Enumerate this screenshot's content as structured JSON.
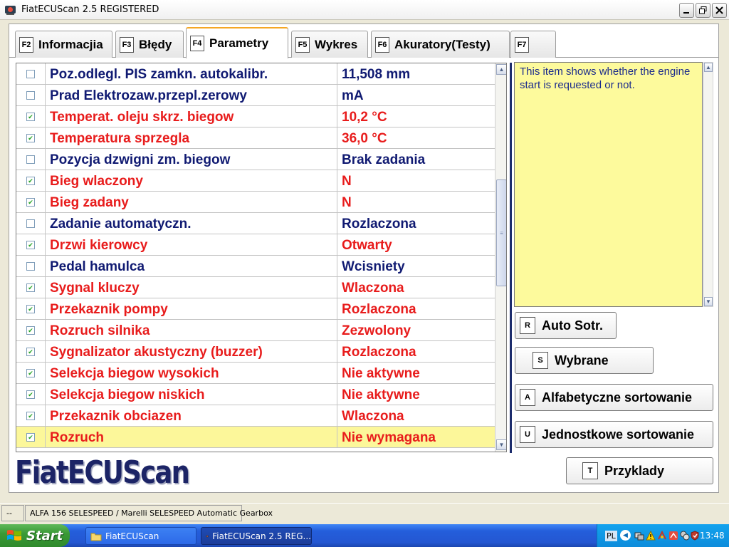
{
  "window": {
    "title": "FiatECUScan 2.5 REGISTERED"
  },
  "tabs": [
    {
      "key": "F2",
      "label": "Informacjia",
      "active": false
    },
    {
      "key": "F3",
      "label": "Błędy",
      "active": false
    },
    {
      "key": "F4",
      "label": "Parametry",
      "active": true
    },
    {
      "key": "F5",
      "label": "Wykres",
      "active": false
    },
    {
      "key": "F6",
      "label": "Akuratory(Testy)",
      "active": false
    },
    {
      "key": "F7",
      "label": "",
      "active": false
    }
  ],
  "parameters": [
    {
      "checked": false,
      "name": "Poz.odlegl. PIS zamkn. autokalibr.",
      "value": "11,508 mm",
      "color": "blue"
    },
    {
      "checked": false,
      "name": "Prad Elektrozaw.przepl.zerowy",
      "value": " mA",
      "color": "blue"
    },
    {
      "checked": true,
      "name": "Temperat. oleju skrz. biegow",
      "value": "10,2 °C",
      "color": "red"
    },
    {
      "checked": true,
      "name": "Temperatura sprzegla",
      "value": "36,0 °C",
      "color": "red"
    },
    {
      "checked": false,
      "name": "Pozycja dzwigni zm. biegow",
      "value": "Brak zadania",
      "color": "blue"
    },
    {
      "checked": true,
      "name": "Bieg wlaczony",
      "value": "N",
      "color": "red"
    },
    {
      "checked": true,
      "name": "Bieg zadany",
      "value": "N",
      "color": "red"
    },
    {
      "checked": false,
      "name": "Zadanie automatyczn.",
      "value": "Rozlaczona",
      "color": "blue"
    },
    {
      "checked": true,
      "name": "Drzwi kierowcy",
      "value": "Otwarty",
      "color": "red"
    },
    {
      "checked": false,
      "name": "Pedal hamulca",
      "value": "Wcisniety",
      "color": "blue"
    },
    {
      "checked": true,
      "name": "Sygnal kluczy",
      "value": "Wlaczona",
      "color": "red"
    },
    {
      "checked": true,
      "name": "Przekaznik pompy",
      "value": "Rozlaczona",
      "color": "red"
    },
    {
      "checked": true,
      "name": "Rozruch silnika",
      "value": "Zezwolony",
      "color": "red"
    },
    {
      "checked": true,
      "name": "Sygnalizator akustyczny (buzzer)",
      "value": "Rozlaczona",
      "color": "red"
    },
    {
      "checked": true,
      "name": "Selekcja biegow wysokich",
      "value": "Nie aktywne",
      "color": "red"
    },
    {
      "checked": true,
      "name": "Selekcja biegow niskich",
      "value": "Nie aktywne",
      "color": "red"
    },
    {
      "checked": true,
      "name": "Przekaznik obciazen",
      "value": "Wlaczona",
      "color": "red"
    },
    {
      "checked": true,
      "name": "Rozruch",
      "value": "Nie wymagana",
      "color": "red",
      "selected": true
    }
  ],
  "description": "This item shows whether the engine start is requested or not.",
  "buttons": {
    "auto": {
      "key": "R",
      "label": "Auto Sotr."
    },
    "selected": {
      "key": "S",
      "label": "Wybrane"
    },
    "alpha": {
      "key": "A",
      "label": "Alfabetyczne sortowanie"
    },
    "unit": {
      "key": "U",
      "label": "Jednostkowe sortowanie"
    },
    "examples": {
      "key": "T",
      "label": "Przyklady"
    }
  },
  "logo": "FiatECUScan",
  "statusbar": {
    "left": "--",
    "vehicle": "ALFA 156 SELESPEED / Marelli SELESPEED Automatic Gearbox"
  },
  "taskbar": {
    "start": "Start",
    "tasks": [
      "FiatECUScan",
      "FiatECUScan 2.5 REG..."
    ],
    "language": "PL",
    "clock": "13:48"
  },
  "colors": {
    "red": "#e81c1c",
    "blue": "#101a72",
    "selected_row": "#fcf79a",
    "description_bg": "#fdfa9c",
    "accent": "#f5a623"
  }
}
